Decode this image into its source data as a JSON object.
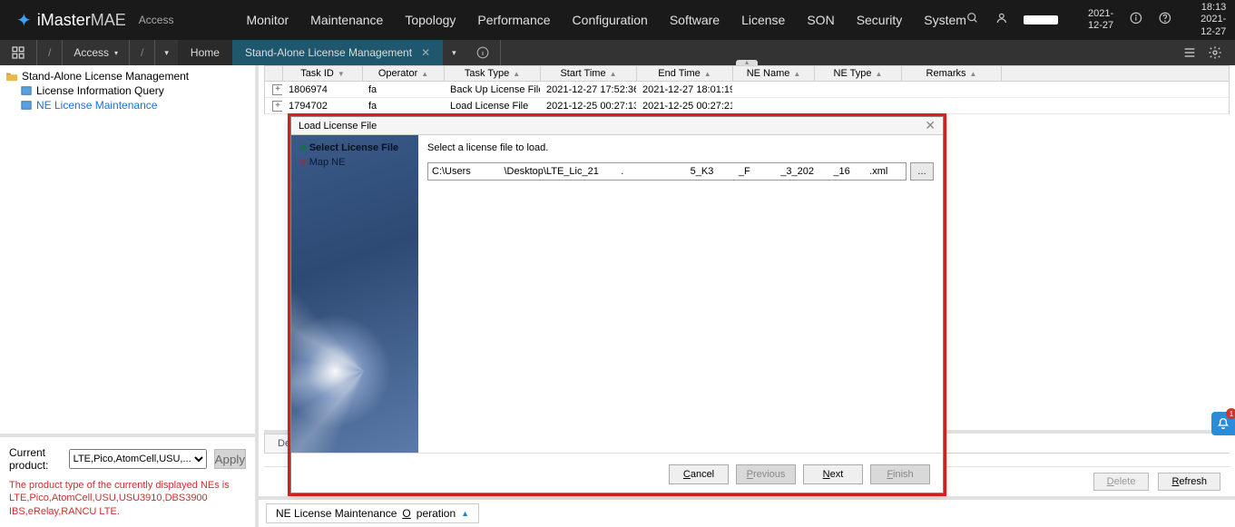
{
  "header": {
    "brand_main": "iMaster",
    "brand_sub": "MAE",
    "brand_section": "Access",
    "nav": [
      "Monitor",
      "Maintenance",
      "Topology",
      "Performance",
      "Configuration",
      "Software",
      "License",
      "SON",
      "Security",
      "System"
    ],
    "time": "18:13",
    "date": "2021-12-27"
  },
  "tabbar": {
    "access": "Access",
    "home": "Home",
    "active_tab": "Stand-Alone License Management"
  },
  "tree": {
    "root": "Stand-Alone License Management",
    "item1": "License Information Query",
    "item2": "NE License Maintenance"
  },
  "filter": {
    "label": "Current product:",
    "value": "LTE,Pico,AtomCell,USU,...",
    "apply": "Apply",
    "note": "The product type of the currently displayed NEs is LTE,Pico,AtomCell,USU,USU3910,DBS3900 IBS,eRelay,RANCU LTE."
  },
  "table": {
    "headers": [
      "Task ID",
      "Operator",
      "Task Type",
      "Start Time",
      "End Time",
      "NE Name",
      "NE Type",
      "Remarks"
    ],
    "rows": [
      {
        "id": "1806974",
        "op": "fa",
        "type": "Back Up License File",
        "start": "2021-12-27 17:52:36",
        "end": "2021-12-27 18:01:19",
        "nename": "",
        "netype": "",
        "rem": ""
      },
      {
        "id": "1794702",
        "op": "fa",
        "type": "Load License File",
        "start": "2021-12-25 00:27:13",
        "end": "2021-12-25 00:27:21",
        "nename": "",
        "netype": "",
        "rem": ""
      }
    ]
  },
  "detail_tab": "De",
  "bottom": {
    "delete": "Delete",
    "refresh": "Refresh",
    "delete_ul": "D",
    "refresh_ul": "R"
  },
  "opbar": {
    "label": "NE License Maintenance ",
    "label_ul": "O",
    "label_rest": "peration"
  },
  "fab_badge": "1",
  "dialog": {
    "title": "Load License File",
    "step1": "Select License File",
    "step2": "Map NE",
    "prompt": "Select a license file to load.",
    "path": "C:\\Users            \\Desktop\\LTE_Lic_21        .                        5_K3         _F           _3_202       _16       .xml",
    "browse": "…",
    "cancel": "Cancel",
    "cancel_ul": "C",
    "prev": "Previous",
    "prev_ul": "P",
    "next": "Next",
    "next_ul": "N",
    "finish": "Finish",
    "finish_ul": "F"
  }
}
